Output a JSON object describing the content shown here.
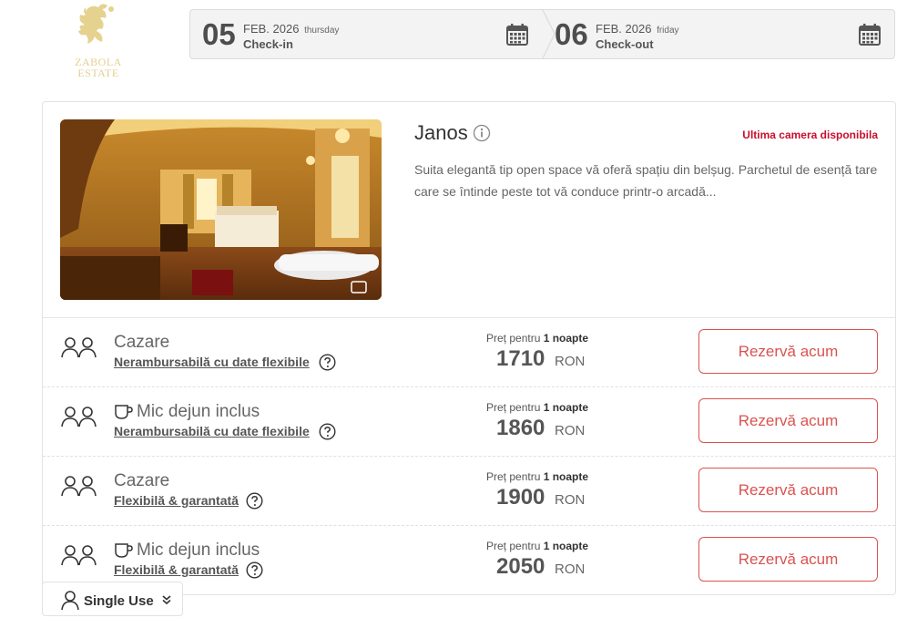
{
  "brand": {
    "logo_line1": "ZABOLA",
    "logo_line2": "ESTATE",
    "logo_color": "#e3cf8f"
  },
  "checkin": {
    "day": "05",
    "month": "FEB. 2026",
    "weekday": "thursday",
    "label": "Check-in",
    "icon": "calendar-icon"
  },
  "checkout": {
    "day": "06",
    "month": "FEB. 2026",
    "weekday": "friday",
    "label": "Check-out",
    "icon": "calendar-icon"
  },
  "room": {
    "name": "Janos",
    "availability": "Ultima camera disponibila",
    "description": "Suita elegantă tip open space vă oferă spațiu din belșug. Parchetul de esență tare care se întinde peste tot vă conduce printr-o arcadă..."
  },
  "rates": [
    {
      "title": "Cazare",
      "breakfast": false,
      "policy": "Nerambursabilă cu date flexibile",
      "price_prefix": "Preț pentru",
      "nights": "1 noapte",
      "price": "1710",
      "currency": "RON",
      "button": "Rezervă acum"
    },
    {
      "title": "Mic dejun inclus",
      "breakfast": true,
      "policy": "Nerambursabilă cu date flexibile",
      "price_prefix": "Preț pentru",
      "nights": "1 noapte",
      "price": "1860",
      "currency": "RON",
      "button": "Rezervă acum"
    },
    {
      "title": "Cazare",
      "breakfast": false,
      "policy": "Flexibilă & garantată",
      "price_prefix": "Preț pentru",
      "nights": "1 noapte",
      "price": "1900",
      "currency": "RON",
      "button": "Rezervă acum"
    },
    {
      "title": "Mic dejun inclus",
      "breakfast": true,
      "policy": "Flexibilă & garantată",
      "price_prefix": "Preț pentru",
      "nights": "1 noapte",
      "price": "2050",
      "currency": "RON",
      "button": "Rezervă acum"
    }
  ],
  "occupancy": {
    "label": "Single Use"
  },
  "colors": {
    "accent": "#d9534f",
    "alert": "#c8102e"
  }
}
